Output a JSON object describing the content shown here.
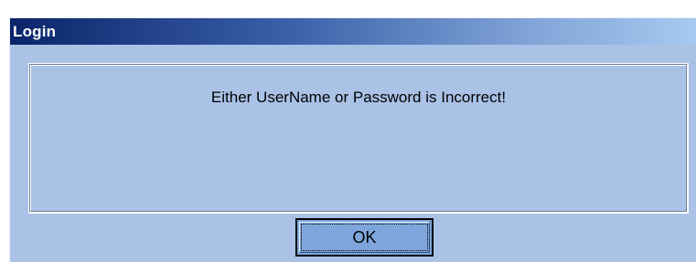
{
  "window": {
    "title": "Login"
  },
  "message": {
    "text": "Either UserName or Password is Incorrect!"
  },
  "buttons": {
    "ok_label": "OK"
  },
  "colors": {
    "dialog_background": "#a9c2e6",
    "titlebar_start": "#0a246a",
    "titlebar_end": "#a6caf0",
    "button_face": "#7fa6dc"
  }
}
